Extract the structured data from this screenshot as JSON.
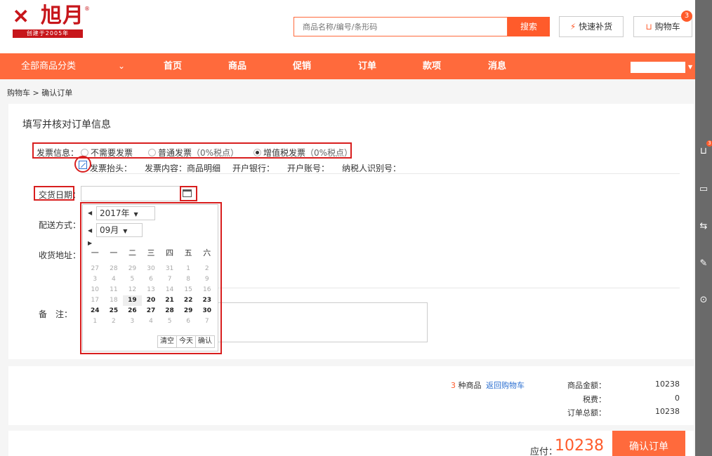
{
  "logo": {
    "mark": "✕",
    "name": "旭月",
    "reg": "®",
    "sub": "创建于2005年"
  },
  "header": {
    "search_placeholder": "商品名称/编号/条形码",
    "search_label": "搜索",
    "quick_restock_icon": "⚡",
    "quick_restock_label": "快速补货",
    "cart_icon": "🛒",
    "cart_label": "购物车",
    "cart_count": "3"
  },
  "nav": {
    "all_categories": "全部商品分类",
    "arrow": "⌄",
    "items": [
      "首页",
      "商品",
      "促销",
      "订单",
      "款项",
      "消息"
    ]
  },
  "breadcrumb": "购物车 > 确认订单",
  "form": {
    "title": "填写并核对订单信息",
    "invoice": {
      "label": "发票信息：",
      "options": [
        "不需要发票",
        "普通发票",
        "增值税发票"
      ],
      "option_notes": [
        "",
        "（0%税点）",
        "（0%税点）"
      ],
      "selected": "增值税发票",
      "details": [
        "发票抬头：",
        "发票内容：商品明细",
        "开户银行：",
        "开户账号：",
        "纳税人识别号："
      ]
    },
    "delivery_date": {
      "label": "交货日期",
      "colon": "：",
      "value": ""
    },
    "shipping_label": "配送方式：",
    "address_label": "收货地址：",
    "remark_label": "备　注："
  },
  "calendar": {
    "year": "2017年",
    "month": "09月",
    "weekdays": [
      "一",
      "一",
      "二",
      "三",
      "四",
      "五",
      "六"
    ],
    "days": [
      [
        "27",
        "28",
        "29",
        "30",
        "31",
        "1",
        "2"
      ],
      [
        "3",
        "4",
        "5",
        "6",
        "7",
        "8",
        "9"
      ],
      [
        "10",
        "11",
        "12",
        "13",
        "14",
        "15",
        "16"
      ],
      [
        "17",
        "18",
        "19",
        "20",
        "21",
        "22",
        "23"
      ],
      [
        "24",
        "25",
        "26",
        "27",
        "28",
        "29",
        "30"
      ],
      [
        "1",
        "2",
        "3",
        "4",
        "5",
        "6",
        "7"
      ]
    ],
    "active_from": [
      3,
      2
    ],
    "active_to": [
      4,
      6
    ],
    "today": [
      3,
      2
    ],
    "buttons": [
      "清空",
      "今天",
      "确认"
    ]
  },
  "summary": {
    "count": "3",
    "count_suffix": "种商品",
    "back_link": "返回购物车",
    "rows": [
      {
        "label": "商品金额：",
        "value": "10238"
      },
      {
        "label": "税费：",
        "value": "0"
      },
      {
        "label": "订单总额：",
        "value": "10238"
      }
    ]
  },
  "payment": {
    "label": "应付：",
    "amount": "10238",
    "confirm": "确认订单"
  },
  "rail": {
    "cart_count": "3",
    "icons": [
      "cart-icon",
      "chat-icon",
      "link-icon",
      "edit-icon",
      "top-icon"
    ]
  }
}
